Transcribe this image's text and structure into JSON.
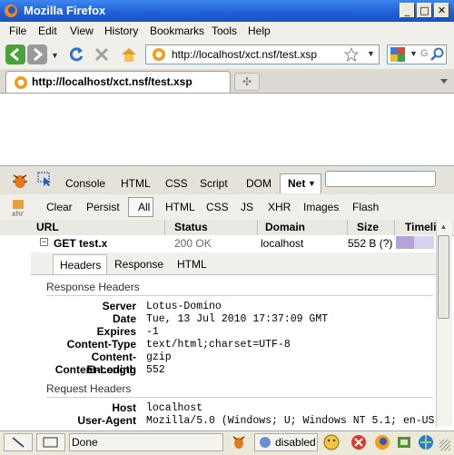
{
  "window": {
    "title": "Mozilla Firefox",
    "brand_color": "#1f5fd6"
  },
  "menu": [
    "File",
    "Edit",
    "View",
    "History",
    "Bookmarks",
    "Tools",
    "Help"
  ],
  "navbar": {
    "url": "http://localhost/xct.nsf/test.xsp",
    "search_icon": "magnifier-icon"
  },
  "tab": {
    "title": "http://localhost/xct.nsf/test.xsp"
  },
  "firebug": {
    "panels": [
      "Console",
      "HTML",
      "CSS",
      "Script",
      "DOM",
      "Net"
    ],
    "active_panel": "Net",
    "net_toolbar": [
      "Clear",
      "Persist",
      "All",
      "HTML",
      "CSS",
      "JS",
      "XHR",
      "Images",
      "Flash"
    ],
    "columns": [
      "URL",
      "Status",
      "Domain",
      "Size",
      "Timeli"
    ],
    "request": {
      "url": "GET test.х",
      "status": "200 OK",
      "domain": "localhost",
      "size": "552 B (?)"
    },
    "detail_tabs": [
      "Headers",
      "Response",
      "HTML"
    ],
    "response_headers_title": "Response Headers",
    "response_headers": [
      {
        "name": "Server",
        "value": "Lotus-Domino"
      },
      {
        "name": "Date",
        "value": "Tue, 13 Jul 2010 17:37:09 GMT"
      },
      {
        "name": "Expires",
        "value": "-1"
      },
      {
        "name": "Content-Type",
        "value": "text/html;charset=UTF-8"
      },
      {
        "name": "Content-Encoding",
        "value": "gzip"
      },
      {
        "name": "Content-Length",
        "value": "552"
      }
    ],
    "request_headers_title": "Request Headers",
    "request_headers": [
      {
        "name": "Host",
        "value": "localhost"
      },
      {
        "name": "User-Agent",
        "value": "Mozilla/5.0 (Windows; U; Windows NT 5.1; en-US"
      }
    ]
  },
  "status": {
    "text": "Done",
    "disabled_label": "disabled"
  }
}
